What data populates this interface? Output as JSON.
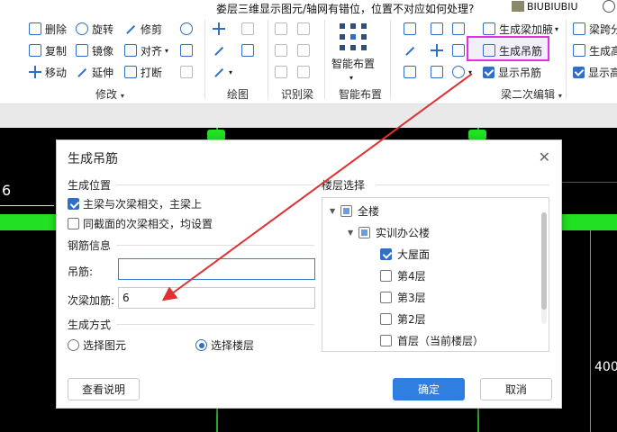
{
  "titlebar": {
    "question": "娄层三维显示图元/轴网有错位，位置不对应如何处理?",
    "username": "BIUBIUBIU"
  },
  "ribbon": {
    "modify": {
      "delete": "删除",
      "rotate": "旋转",
      "trim": "修剪",
      "copy": "复制",
      "mirror": "镜像",
      "align": "对齐",
      "move": "移动",
      "extend": "延伸",
      "break": "打断",
      "label": "修改"
    },
    "draw": {
      "label": "绘图"
    },
    "identify": {
      "label": "识别梁"
    },
    "smart": {
      "button": "智能布置",
      "label": "智能布置"
    },
    "beam_edit": {
      "gen_haunch": "生成梁加腋",
      "gen_hanger": "生成吊筋",
      "show_hanger": "显示吊筋",
      "beam_span": "梁跨分",
      "gen_height": "生成高",
      "show_height": "显示高",
      "label": "梁二次编辑"
    }
  },
  "canvas": {
    "left_text": "6",
    "right_text": "400"
  },
  "dialog": {
    "title": "生成吊筋",
    "close": "✕",
    "position": {
      "header": "生成位置",
      "opt1": "主梁与次梁相交，主梁上",
      "opt2": "同截面的次梁相交，均设置"
    },
    "rebar": {
      "header": "钢筋信息",
      "hanger_label": "吊筋:",
      "hanger_value": "",
      "secondary_label": "次梁加筋:",
      "secondary_value": "6"
    },
    "method": {
      "header": "生成方式",
      "opt1": "选择图元",
      "opt2": "选择楼层"
    },
    "floors": {
      "header": "楼层选择",
      "all": "全楼",
      "building": "实训办公楼",
      "items": [
        "大屋面",
        "第4层",
        "第3层",
        "第2层",
        "首层（当前楼层）"
      ]
    },
    "buttons": {
      "help": "查看说明",
      "ok": "确定",
      "cancel": "取消"
    }
  },
  "colors": {
    "accent": "#2f7fe0",
    "beam_green": "#22e022",
    "highlight_magenta": "#e030e0",
    "arrow_red": "#e03030"
  }
}
